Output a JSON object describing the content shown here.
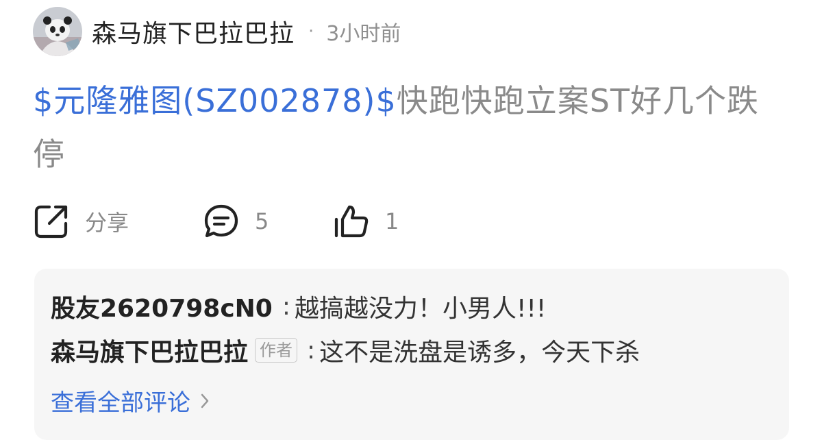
{
  "post": {
    "author": "森马旗下巴拉巴拉",
    "separator": "·",
    "time": "3小时前",
    "stock_link": "$元隆雅图(SZ002878)$",
    "text": "快跑快跑立案ST好几个跌停"
  },
  "actions": {
    "share_label": "分享",
    "comment_count": "5",
    "like_count": "1"
  },
  "comments": [
    {
      "user": "股友2620798cN0",
      "tag": "",
      "colon": ":",
      "text": "越搞越没力！小男人!!!"
    },
    {
      "user": "森马旗下巴拉巴拉",
      "tag": "作者",
      "colon": ":",
      "text": "这不是洗盘是诱多，今天下杀"
    }
  ],
  "view_all_label": "查看全部评论",
  "icons": {
    "avatar": "panda-avatar",
    "share": "share-icon",
    "comment": "comment-icon",
    "like": "thumbs-up-icon",
    "chevron": "chevron-right-icon"
  },
  "colors": {
    "link": "#3a6fd8",
    "muted_text": "#8a8a8a",
    "comment_bg": "#f6f6f6"
  }
}
